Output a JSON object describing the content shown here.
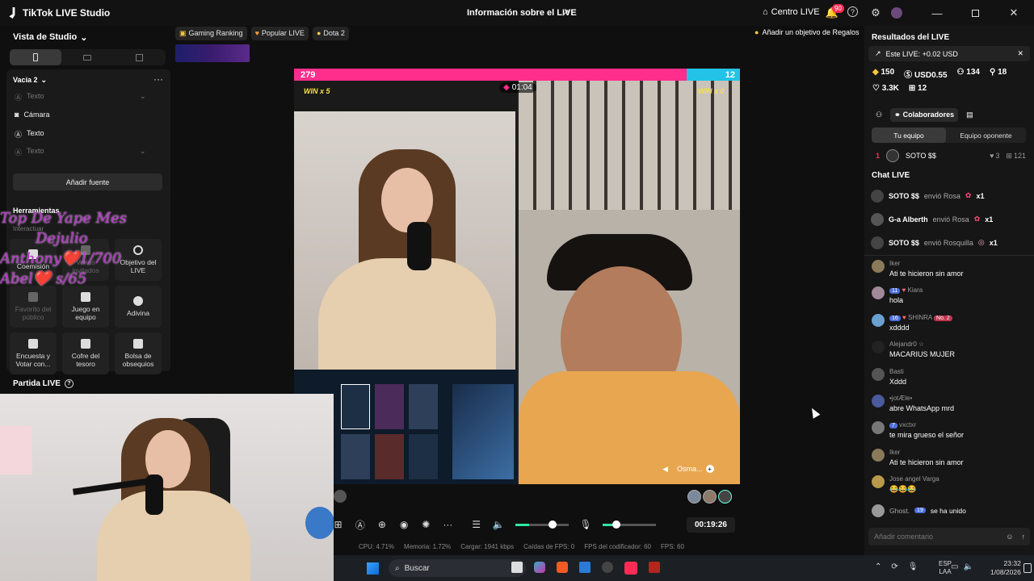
{
  "app": {
    "title": "TikTok LIVE Studio",
    "center_title": "Información sobre el LIVE",
    "centro_live": "Centro LIVE",
    "notif_count": "90"
  },
  "left": {
    "studio_view": "Vista de Studio",
    "scene": "Vacía 2",
    "sources": [
      "Texto",
      "Cámara",
      "Texto",
      "Texto"
    ],
    "add_source": "Añadir fuente",
    "tools_title": "Herramientas",
    "tools_subtitle": "Interactuar",
    "tools": [
      "Coemisión",
      "Varios invitados",
      "Objetivo del LIVE",
      "Favorito del público",
      "Juego en equipo",
      "Adivina",
      "Encuesta y Votar con...",
      "Cofre del tesoro",
      "Bolsa de obsequios"
    ],
    "partida": "Partida LIVE"
  },
  "overlay_text": {
    "line1": "Top De Yape  Mes",
    "line2": "Dejulio",
    "line3": "Anthony❤️1/700",
    "line4": "Abel❤️       s/65"
  },
  "top_tabs": [
    "Gaming Ranking",
    "Popular LIVE",
    "Dota 2"
  ],
  "add_goal": "Añadir un objetivo de Regalos",
  "stage": {
    "score_left": "279",
    "score_right": "12",
    "win_left": "WIN x 5",
    "win_right": "WIN x 0",
    "timer": "01:04",
    "guest_name": "Osma..."
  },
  "controls": {
    "elapsed": "00:19:26"
  },
  "stats": {
    "cpu": "CPU: 4.71%",
    "mem": "Memoria: 1.72%",
    "load": "Cargar: 1941 kbps",
    "fps_drop": "Caídas de FPS: 0",
    "enc_fps": "FPS del codificador: 60",
    "fps": "FPS: 60"
  },
  "right": {
    "results_title": "Resultados del LIVE",
    "este_live": "Este LIVE: +0.02 USD",
    "metrics": [
      "150",
      "USD0.55",
      "134",
      "18",
      "3.3K",
      "12"
    ],
    "collab": "Colaboradores",
    "tab_mine": "Tu equipo",
    "tab_opp": "Equipo oponente",
    "rank_num": "1",
    "rank_name": "SOTO $$",
    "rank_likes": "3",
    "rank_gifts": "121",
    "chat_title": "Chat LIVE",
    "gifts": [
      {
        "user": "SOTO $$",
        "action": "envió Rosa",
        "count": "x1"
      },
      {
        "user": "G-a Alberth",
        "action": "envió Rosa",
        "count": "x1"
      },
      {
        "user": "SOTO $$",
        "action": "envió Rosquilla",
        "count": "x1"
      }
    ],
    "messages": [
      {
        "name": "Iker",
        "msg": "Ati te hicieron sin amor"
      },
      {
        "name": "Kiara",
        "msg": "hola",
        "lvl": "11"
      },
      {
        "name": "SHINRA",
        "msg": "xdddd",
        "lvl": "16",
        "rank": "No. 2"
      },
      {
        "name": "Alejandr0 ☆",
        "msg": "MACARIUS MUJER"
      },
      {
        "name": "Basti",
        "msg": "Xddd"
      },
      {
        "name": "•jotÆle•",
        "msg": "abre WhatsApp mrd"
      },
      {
        "name": "vxctxr",
        "msg": "te mira grueso el señor",
        "lvl": "7"
      },
      {
        "name": "Iker",
        "msg": "Ati te hicieron sin amor"
      },
      {
        "name": "Jose angel Varga",
        "msg": "😂😂😂"
      }
    ],
    "join_user": "Ghost.",
    "join_lvl": "19",
    "join_text": "se ha unido",
    "comment_placeholder": "Añadir comentario"
  },
  "taskbar": {
    "search": "Buscar",
    "lang1": "ESP",
    "lang2": "LAA",
    "time": "23:32",
    "date": "1/08/2026"
  },
  "colors": {
    "accent": "#fe2c55",
    "score_left": "#ff2d8c",
    "score_right": "#22c3e6"
  }
}
